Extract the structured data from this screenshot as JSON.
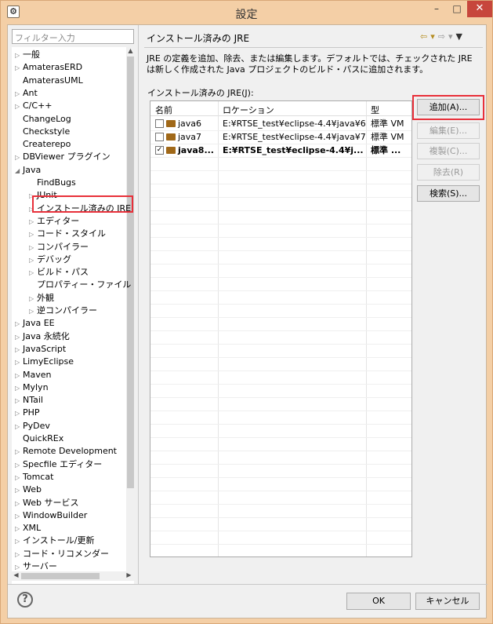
{
  "window": {
    "title": "設定",
    "minimize": "–",
    "maximize": "□",
    "close": "✕"
  },
  "filter": {
    "placeholder": "フィルター入力"
  },
  "tree": [
    {
      "label": "一般",
      "arrow": "▷",
      "indent": 0
    },
    {
      "label": "AmaterasERD",
      "arrow": "▷",
      "indent": 0
    },
    {
      "label": "AmaterasUML",
      "arrow": "",
      "indent": 0
    },
    {
      "label": "Ant",
      "arrow": "▷",
      "indent": 0
    },
    {
      "label": "C/C++",
      "arrow": "▷",
      "indent": 0
    },
    {
      "label": "ChangeLog",
      "arrow": "",
      "indent": 0
    },
    {
      "label": "Checkstyle",
      "arrow": "",
      "indent": 0
    },
    {
      "label": "Createrepo",
      "arrow": "",
      "indent": 0
    },
    {
      "label": "DBViewer プラグイン",
      "arrow": "▷",
      "indent": 0
    },
    {
      "label": "Java",
      "arrow": "◢",
      "indent": 0
    },
    {
      "label": "FindBugs",
      "arrow": "",
      "indent": 1
    },
    {
      "label": "JUnit",
      "arrow": "▷",
      "indent": 1
    },
    {
      "label": "インストール済みの JRE",
      "arrow": "▷",
      "indent": 1
    },
    {
      "label": "エディター",
      "arrow": "▷",
      "indent": 1
    },
    {
      "label": "コード・スタイル",
      "arrow": "▷",
      "indent": 1
    },
    {
      "label": "コンパイラー",
      "arrow": "▷",
      "indent": 1
    },
    {
      "label": "デバッグ",
      "arrow": "▷",
      "indent": 1
    },
    {
      "label": "ビルド・パス",
      "arrow": "▷",
      "indent": 1
    },
    {
      "label": "プロパティー・ファイル・エ",
      "arrow": "",
      "indent": 1
    },
    {
      "label": "外観",
      "arrow": "▷",
      "indent": 1
    },
    {
      "label": "逆コンパイラー",
      "arrow": "▷",
      "indent": 1
    },
    {
      "label": "Java EE",
      "arrow": "▷",
      "indent": 0
    },
    {
      "label": "Java 永続化",
      "arrow": "▷",
      "indent": 0
    },
    {
      "label": "JavaScript",
      "arrow": "▷",
      "indent": 0
    },
    {
      "label": "LimyEclipse",
      "arrow": "▷",
      "indent": 0
    },
    {
      "label": "Maven",
      "arrow": "▷",
      "indent": 0
    },
    {
      "label": "Mylyn",
      "arrow": "▷",
      "indent": 0
    },
    {
      "label": "NTail",
      "arrow": "▷",
      "indent": 0
    },
    {
      "label": "PHP",
      "arrow": "▷",
      "indent": 0
    },
    {
      "label": "PyDev",
      "arrow": "▷",
      "indent": 0
    },
    {
      "label": "QuickREx",
      "arrow": "",
      "indent": 0
    },
    {
      "label": "Remote Development",
      "arrow": "▷",
      "indent": 0
    },
    {
      "label": "Specfile エディター",
      "arrow": "▷",
      "indent": 0
    },
    {
      "label": "Tomcat",
      "arrow": "▷",
      "indent": 0
    },
    {
      "label": "Web",
      "arrow": "▷",
      "indent": 0
    },
    {
      "label": "Web サービス",
      "arrow": "▷",
      "indent": 0
    },
    {
      "label": "WindowBuilder",
      "arrow": "▷",
      "indent": 0
    },
    {
      "label": "XML",
      "arrow": "▷",
      "indent": 0
    },
    {
      "label": "インストール/更新",
      "arrow": "▷",
      "indent": 0
    },
    {
      "label": "コード・リコメンダー",
      "arrow": "▷",
      "indent": 0
    },
    {
      "label": "サーバー",
      "arrow": "▷",
      "indent": 0
    }
  ],
  "page": {
    "title": "インストール済みの JRE",
    "description": "JRE の定義を追加、除去、または編集します。デフォルトでは、チェックされた JRE は新しく作成された Java プロジェクトのビルド・パスに追加されます。",
    "group_label": "インストール済みの JRE(J):",
    "columns": [
      "名前",
      "ロケーション",
      "型"
    ],
    "rows": [
      {
        "name": "java6",
        "location": "E:¥RTSE_test¥eclipse-4.4¥java¥6",
        "type": "標準 VM",
        "checked": false,
        "bold": false
      },
      {
        "name": "java7",
        "location": "E:¥RTSE_test¥eclipse-4.4¥java¥7",
        "type": "標準 VM",
        "checked": false,
        "bold": false
      },
      {
        "name": "java8...",
        "location": "E:¥RTSE_test¥eclipse-4.4¥j...",
        "type": "標準 ...",
        "checked": true,
        "bold": true
      }
    ],
    "buttons": {
      "add": "追加(A)...",
      "edit": "編集(E)...",
      "copy": "複製(C)...",
      "remove": "除去(R)",
      "search": "検索(S)..."
    }
  },
  "footer": {
    "ok": "OK",
    "cancel": "キャンセル",
    "help": "?"
  },
  "colors": {
    "highlight": "#e8303a",
    "titlebar": "#f4cfa6",
    "close": "#c7463c"
  }
}
